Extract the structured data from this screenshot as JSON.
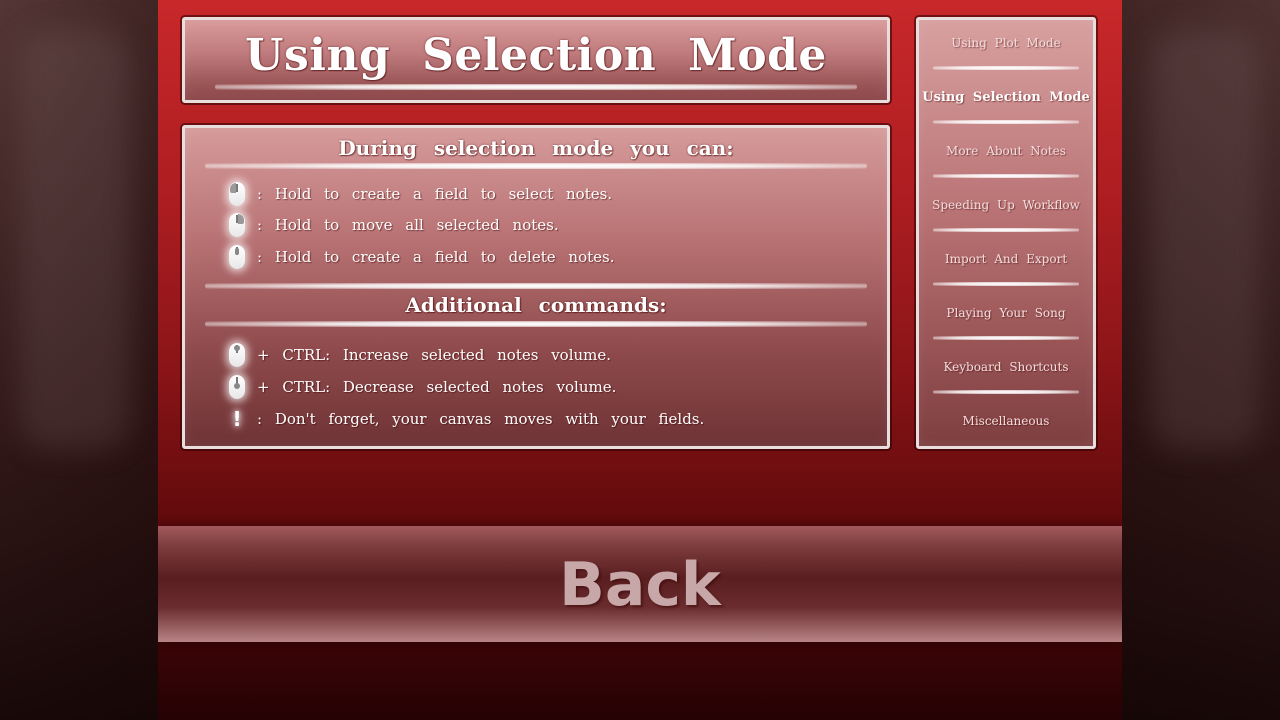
{
  "page_title": "Using Selection Mode",
  "content": {
    "section1_heading": "During selection mode you can:",
    "section1_items": [
      {
        "icon": "mouse-left-click-icon",
        "text": ": Hold to create a field to select notes."
      },
      {
        "icon": "mouse-right-click-icon",
        "text": ": Hold to move all selected notes."
      },
      {
        "icon": "mouse-middle-click-icon",
        "text": ": Hold to create a field to delete notes."
      }
    ],
    "section2_heading": "Additional commands:",
    "section2_items": [
      {
        "icon": "mouse-wheel-up-icon",
        "text": "+ CTRL: Increase selected notes volume."
      },
      {
        "icon": "mouse-wheel-down-icon",
        "text": "+ CTRL: Decrease selected notes volume."
      },
      {
        "icon": "exclamation-icon",
        "text": ": Don't forget, your canvas moves with your fields."
      }
    ]
  },
  "nav": {
    "items": [
      {
        "label": "Using Plot Mode"
      },
      {
        "label": "Using Selection Mode",
        "active": true
      },
      {
        "label": "More About Notes"
      },
      {
        "label": "Speeding Up Workflow"
      },
      {
        "label": "Import And Export"
      },
      {
        "label": "Playing Your Song"
      },
      {
        "label": "Keyboard Shortcuts"
      },
      {
        "label": "Miscellaneous"
      }
    ]
  },
  "back_label": "Back",
  "colors": {
    "stage_red": "#c8282a",
    "panel_pink": "#d99a9a",
    "back_text": "#c8a7a8"
  }
}
